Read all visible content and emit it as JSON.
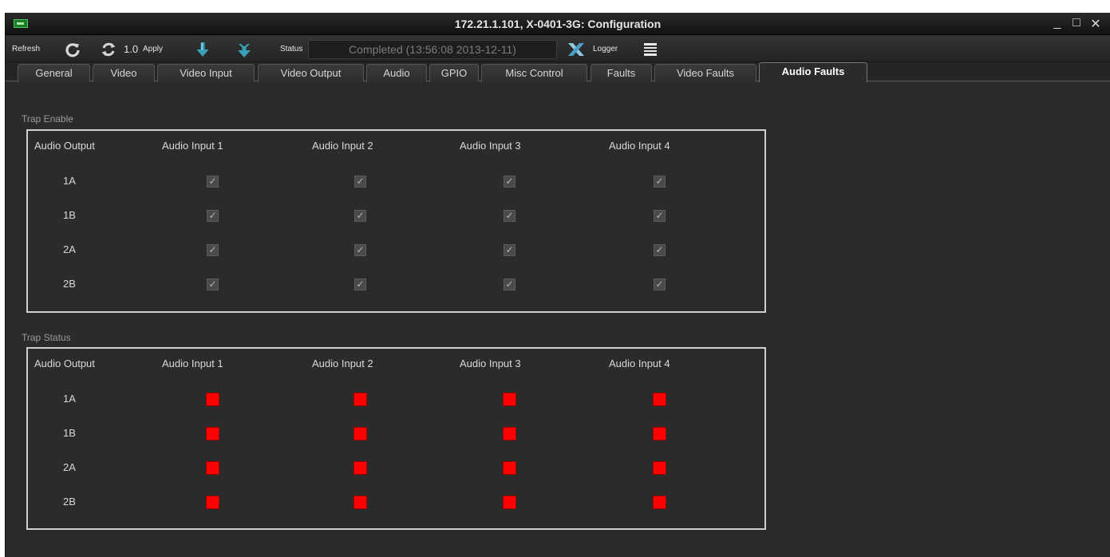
{
  "window": {
    "title": "172.21.1.101, X-0401-3G: Configuration",
    "minimize_label": "_",
    "maximize_label": "□",
    "close_label": "✕"
  },
  "toolbar": {
    "refresh_label": "Refresh",
    "version_label": "1.0",
    "apply_label": "Apply",
    "status_label": "Status",
    "status_value": "Completed  (13:56:08  2013-12-11)",
    "logger_label": "Logger"
  },
  "tabs": [
    {
      "label": "General"
    },
    {
      "label": "Video"
    },
    {
      "label": "Video Input"
    },
    {
      "label": "Video Output"
    },
    {
      "label": "Audio"
    },
    {
      "label": "GPIO"
    },
    {
      "label": "Misc Control"
    },
    {
      "label": "Faults"
    },
    {
      "label": "Video Faults"
    },
    {
      "label": "Audio Faults",
      "active": true
    }
  ],
  "trap_enable": {
    "title": "Trap Enable",
    "headers": [
      "Audio Output",
      "Audio Input 1",
      "Audio Input 2",
      "Audio Input 3",
      "Audio Input 4"
    ],
    "rows": [
      {
        "label": "1A",
        "checked": [
          true,
          true,
          true,
          true
        ]
      },
      {
        "label": "1B",
        "checked": [
          true,
          true,
          true,
          true
        ]
      },
      {
        "label": "2A",
        "checked": [
          true,
          true,
          true,
          true
        ]
      },
      {
        "label": "2B",
        "checked": [
          true,
          true,
          true,
          true
        ]
      }
    ]
  },
  "trap_status": {
    "title": "Trap Status",
    "headers": [
      "Audio Output",
      "Audio Input 1",
      "Audio Input 2",
      "Audio Input 3",
      "Audio Input 4"
    ],
    "rows": [
      {
        "label": "1A",
        "status": [
          "fault",
          "fault",
          "fault",
          "fault"
        ]
      },
      {
        "label": "1B",
        "status": [
          "fault",
          "fault",
          "fault",
          "fault"
        ]
      },
      {
        "label": "2A",
        "status": [
          "fault",
          "fault",
          "fault",
          "fault"
        ]
      },
      {
        "label": "2B",
        "status": [
          "fault",
          "fault",
          "fault",
          "fault"
        ]
      }
    ],
    "fault_color": "#ff0000"
  },
  "icons": {
    "refresh": "refresh-icon",
    "auto_refresh": "auto-refresh-icon",
    "download": "download-arrow-icon",
    "download_all": "download-all-icon",
    "clear": "clear-x-icon",
    "logger": "logger-list-icon"
  },
  "colors": {
    "accent_teal": "#3aa0b8",
    "window_bg": "#2b2b2b"
  }
}
